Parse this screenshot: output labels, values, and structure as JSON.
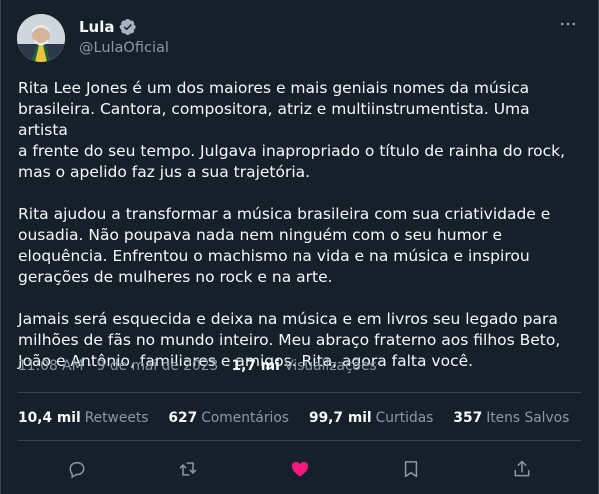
{
  "author": {
    "display_name": "Lula",
    "handle": "@LulaOficial",
    "verified_icon": "verified-badge-icon",
    "more_icon": "more-icon"
  },
  "tweet": {
    "paragraphs": [
      "Rita Lee Jones é um dos maiores e mais geniais nomes da música\nbrasileira. Cantora, compositora, atriz e multiinstrumentista. Uma artista\na frente do seu tempo. Julgava inapropriado o título de rainha do rock,\nmas o apelido faz jus a sua trajetória.",
      "Rita ajudou a transformar a música brasileira com sua criatividade e\nousadia. Não poupava nada nem ninguém com o seu humor e\neloquência. Enfrentou o machismo na vida e na música e inspirou\ngerações de mulheres no rock e na arte.",
      "Jamais será esquecida e deixa na música e em livros seu legado para\nmilhões de fãs no mundo inteiro. Meu abraço fraterno aos filhos Beto,\nJoão e Antônio, familiares e amigos. Rita, agora falta você."
    ]
  },
  "meta": {
    "time": "11:08 AM",
    "sep1": " · ",
    "date": "9 de mai de 2023",
    "sep2": " · ",
    "views_count": "1,7 mi",
    "views_label": " Visualizações"
  },
  "stats": {
    "retweets_count": "10,4 mil",
    "retweets_label": "Retweets",
    "comments_count": "627",
    "comments_label": "Comentários",
    "likes_count": "99,7 mil",
    "likes_label": "Curtidas",
    "saves_count": "357",
    "saves_label": "Itens Salvos"
  },
  "actions": {
    "reply_icon": "reply-icon",
    "retweet_icon": "retweet-icon",
    "like_icon": "heart-icon",
    "bookmark_icon": "bookmark-icon",
    "share_icon": "share-icon"
  },
  "colors": {
    "background": "#15202b",
    "text_primary": "#f7f9f9",
    "text_secondary": "#8b98a5",
    "divider": "#38444d",
    "like_active": "#f91880",
    "verified_blue": "#1d9bf0"
  }
}
